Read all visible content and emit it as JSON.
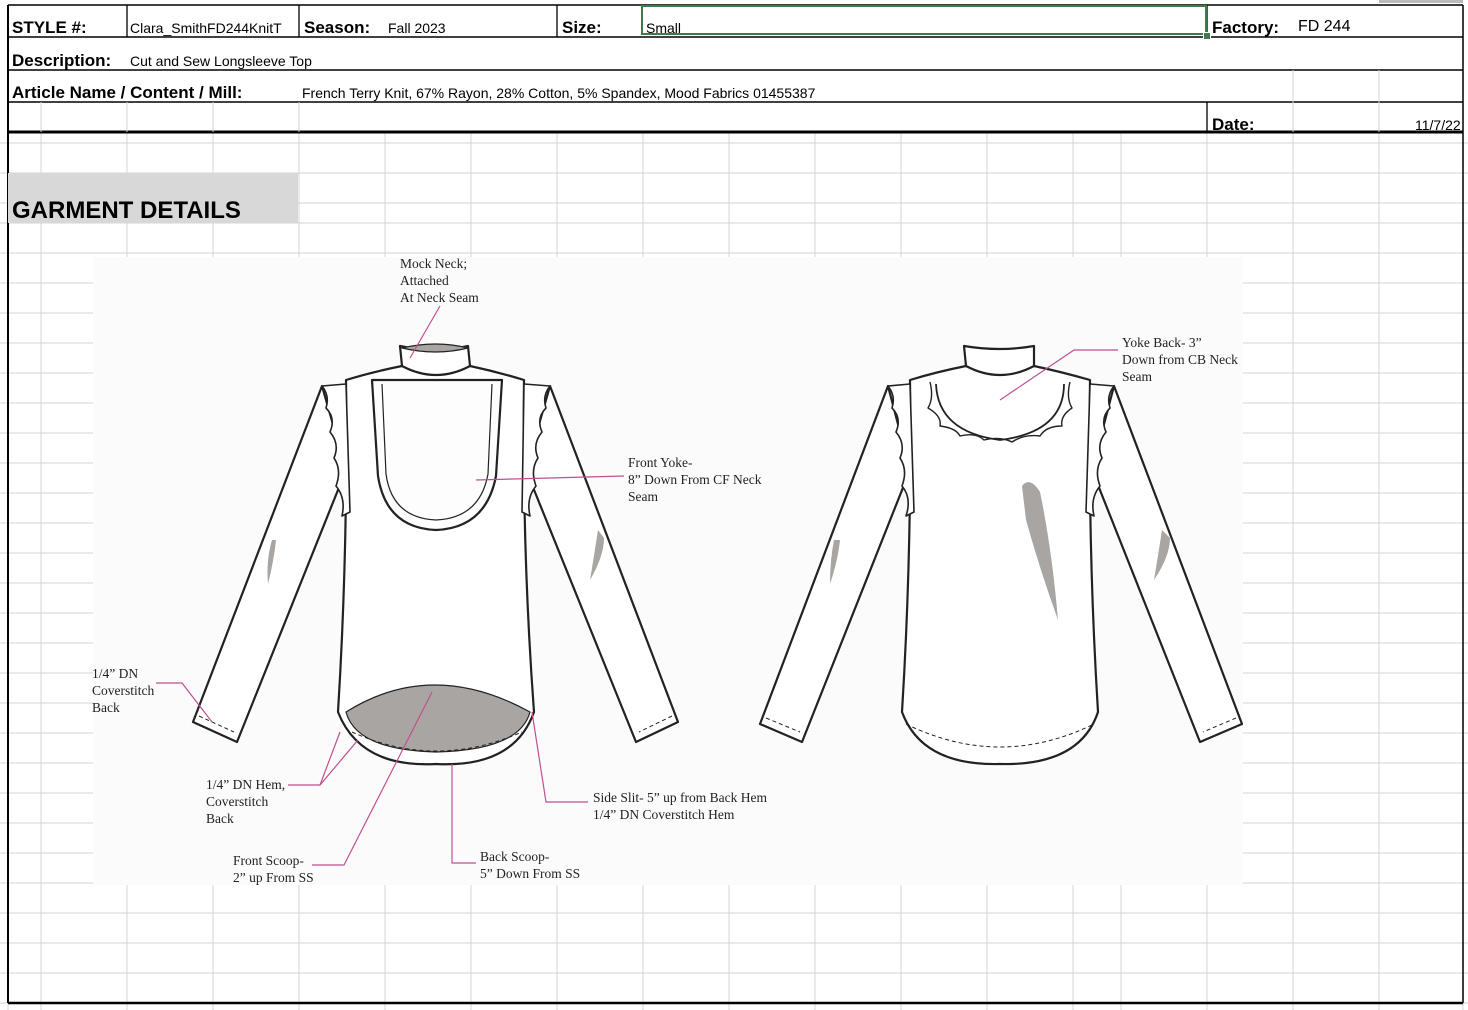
{
  "header": {
    "style_label": "STYLE #:",
    "style_value": "Clara_SmithFD244KnitT",
    "season_label": "Season:",
    "season_value": "Fall 2023",
    "size_label": "Size:",
    "size_value": "Small",
    "factory_label": "Factory:",
    "factory_value": "FD 244",
    "description_label": "Description:",
    "description_value": "Cut and Sew Longsleeve Top",
    "article_label": "Article Name / Content / Mill:",
    "article_value": "French Terry Knit, 67% Rayon, 28% Cotton, 5% Spandex, Mood Fabrics 01455387",
    "date_label": "Date:",
    "date_value": "11/7/22"
  },
  "section": {
    "title": "GARMENT DETAILS"
  },
  "callouts": {
    "mock_neck": "Mock Neck;\nAttached\nAt Neck Seam",
    "front_yoke": "Front Yoke-\n8” Down From CF Neck\nSeam",
    "yoke_back": "Yoke Back- 3”\nDown from CB Neck\nSeam",
    "coverstitch_back": "1/4” DN\nCoverstitch\nBack",
    "hem": "1/4” DN Hem,\nCoverstitch\nBack",
    "front_scoop": "Front Scoop-\n2” up From SS",
    "back_scoop": "Back Scoop-\n5” Down From SS",
    "side_slit": "Side Slit- 5” up from Back Hem\n1/4” DN Coverstitch Hem"
  },
  "colors": {
    "selection": "#3f7a4f",
    "callout_line": "#c0508f",
    "band": "#d8d8d8"
  }
}
